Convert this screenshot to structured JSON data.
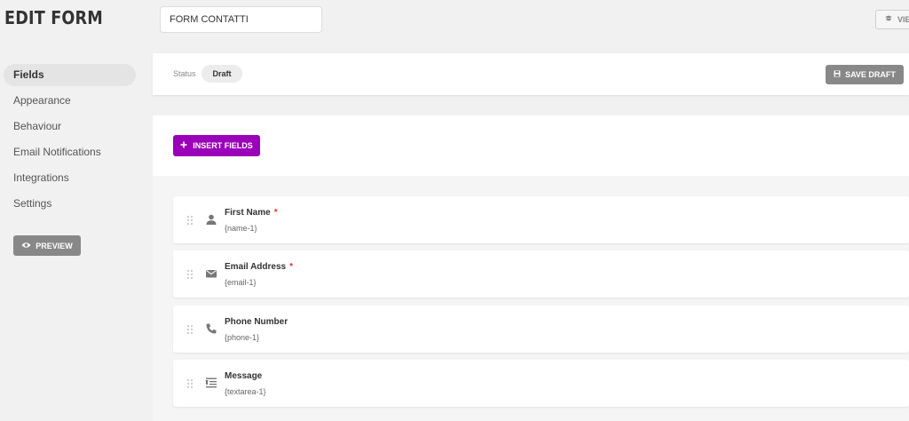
{
  "header": {
    "title": "EDIT FORM",
    "form_name": "FORM CONTATTI",
    "view_label": "VIE"
  },
  "sidebar": {
    "items": [
      {
        "label": "Fields",
        "active": true
      },
      {
        "label": "Appearance",
        "active": false
      },
      {
        "label": "Behaviour",
        "active": false
      },
      {
        "label": "Email Notifications",
        "active": false
      },
      {
        "label": "Integrations",
        "active": false
      },
      {
        "label": "Settings",
        "active": false
      }
    ],
    "preview_label": "PREVIEW"
  },
  "status_bar": {
    "status_label": "Status",
    "status_value": "Draft",
    "save_label": "SAVE DRAFT"
  },
  "builder": {
    "insert_label": "INSERT FIELDS",
    "fields": [
      {
        "label": "First Name",
        "tag": "{name-1}",
        "required": "*",
        "icon": "person-icon"
      },
      {
        "label": "Email Address",
        "tag": "{email-1}",
        "required": "*",
        "icon": "envelope-icon"
      },
      {
        "label": "Phone Number",
        "tag": "{phone-1}",
        "required": "",
        "icon": "phone-icon"
      },
      {
        "label": "Message",
        "tag": "{textarea-1}",
        "required": "",
        "icon": "text-lines-icon"
      }
    ]
  },
  "colors": {
    "accent": "#9b00b8",
    "button_gray": "#888888",
    "required": "#e0322b"
  }
}
